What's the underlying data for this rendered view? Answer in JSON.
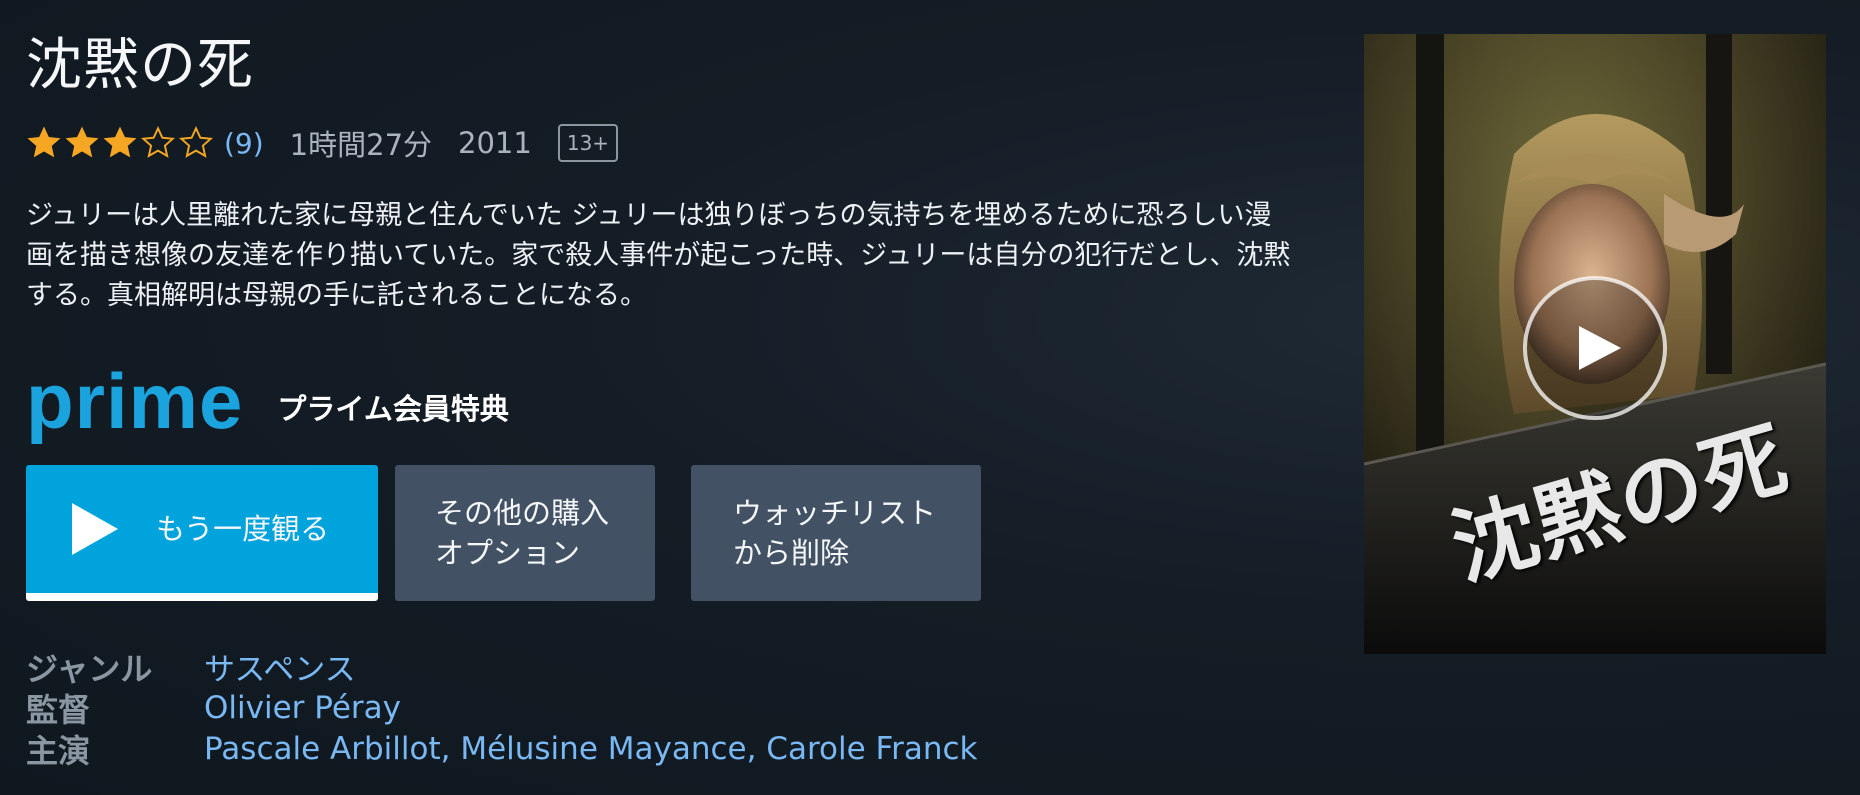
{
  "title": "沈黙の死",
  "rating": {
    "stars": 3,
    "max_stars": 5,
    "count": "(9)"
  },
  "duration": "1時間27分",
  "year": "2011",
  "age_rating": "13+",
  "synopsis": "ジュリーは人里離れた家に母親と住んでいた ジュリーは独りぼっちの気持ちを埋めるために恐ろしい漫画を描き想像の友達を作り描いていた。家で殺人事件が起こった時、ジュリーは自分の犯行だとし、沈黙する。真相解明は母親の手に託されることになる。",
  "prime": {
    "logo_text": "prime",
    "benefit_label": "プライム会員特典"
  },
  "buttons": {
    "play_label": "もう一度観る",
    "purchase_label": "その他の購入\nオプション",
    "watchlist_label": "ウォッチリスト\nから削除"
  },
  "details": [
    {
      "key": "ジャンル",
      "value": "サスペンス"
    },
    {
      "key": "監督",
      "value": "Olivier Péray"
    },
    {
      "key": "主演",
      "value": "Pascale Arbillot, Mélusine Mayance, Carole Franck"
    }
  ],
  "poster": {
    "title": "沈黙の死"
  },
  "colors": {
    "accent": "#00a3dc",
    "star": "#f5a623",
    "link": "#79b8f3",
    "secondary_button": "#425264",
    "background": "#141c25"
  },
  "icons": {
    "star": "star-icon",
    "play": "play-icon",
    "poster_play": "poster-play-icon"
  }
}
